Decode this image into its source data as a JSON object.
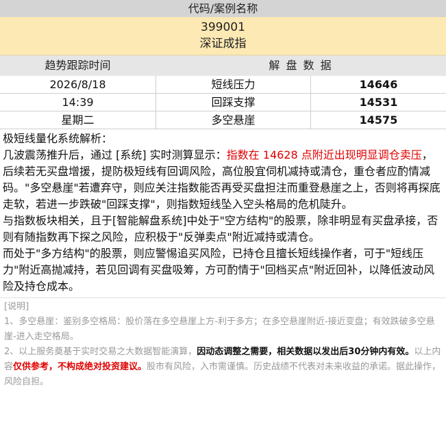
{
  "header": {
    "title": "代码/案例名称",
    "code": "399001",
    "name": "深证成指"
  },
  "table": {
    "col_time": "趋势跟踪时间",
    "col_data": "解 盘 数 据",
    "rows": [
      {
        "time": "2026/8/18",
        "label": "短线压力",
        "value": "14646"
      },
      {
        "time": "14:39",
        "label": "回踩支撑",
        "value": "14531"
      },
      {
        "time": "星期二",
        "label": "多空悬崖",
        "value": "14575"
      }
    ]
  },
  "analysis": {
    "heading": "极短线量化系统解析：",
    "p1_a": "几波震荡推升后，通过 [系统] 实时测算显示：",
    "p1_red": "指数在 14628 点附近出现明显调仓卖压",
    "p1_b": "，后续若无买盘增援，提防极短线有回调风险，高位股宜伺机减持或清仓，重仓者应酌情减码。\"多空悬崖\"若遭弃守，则应关注指数能否再受买盘担注而重登悬崖之上，否则将再探底走软，若进一步跌破\"回踩支撑\"，则指数短线坠入空头格局的危机陡升。",
    "p2": "与指数板块相关，且于[智能解盘系统]中处于\"空方结构\"的股票，除非明显有买盘承接，否则有随指数再下探之风险，应积极于\"反弹卖点\"附近减持或清仓。",
    "p3": "而处于\"多方结构\"的股票，则应警惕追买风险，已持仓且擅长短线操作者，可于\"短线压力\"附近高抛减持，若见回调有买盘吸筹，方可酌情于\"回档买点\"附近回补，以降低波动风险及持仓成本。"
  },
  "notes": {
    "label": "[说明]",
    "n1": "1、多空悬崖：鉴别多空格局：股价落在多空悬崖上方-利于多方；在多空悬崖附近-接近变盘；有效跌破多空悬崖-进入走空格局。",
    "n2_a": "2、以上服务奠基于实时交易之大数据智能演算，",
    "n2_bold": "因动态调整之需要，相关数据以发出后30分钟内有效。",
    "n2_b": "以上内容",
    "n2_red": "仅供参考，不构成绝对投资建议。",
    "n2_c": "股市有风险，入市需谨慎。历史战绩不代表对未来收益的承诺。据此操作，风险自担。"
  }
}
